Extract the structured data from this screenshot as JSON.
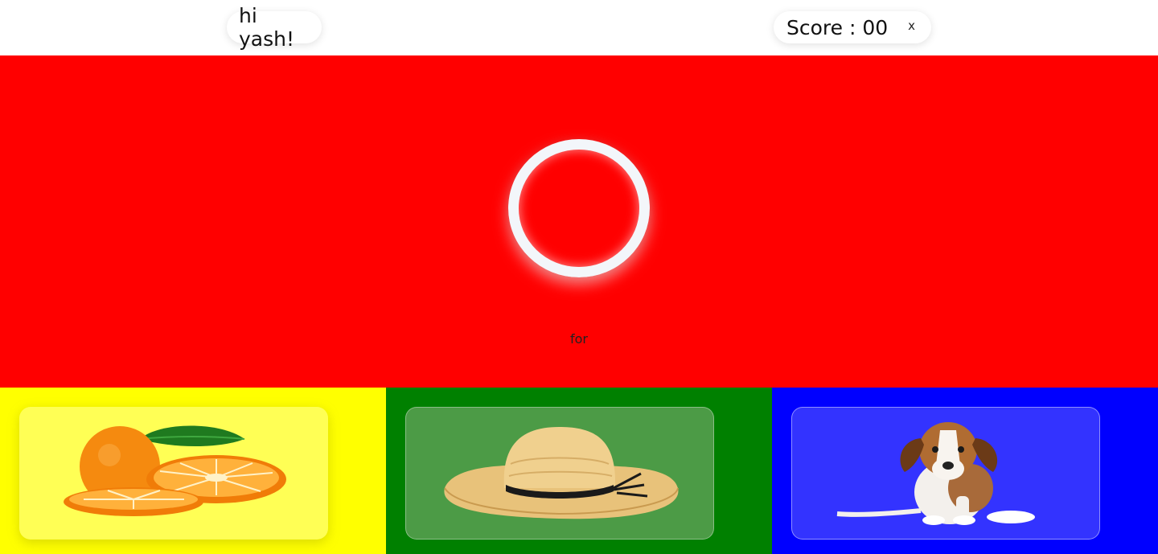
{
  "header": {
    "greeting": "hi yash!",
    "score_label": "Score : 00",
    "close_label": "x"
  },
  "stage": {
    "background_color": "#ff0000",
    "word": "for"
  },
  "options": [
    {
      "icon": "orange-icon",
      "tile_color": "#ffff00"
    },
    {
      "icon": "hat-icon",
      "tile_color": "#008000"
    },
    {
      "icon": "puppy-icon",
      "tile_color": "#0000ff"
    }
  ]
}
